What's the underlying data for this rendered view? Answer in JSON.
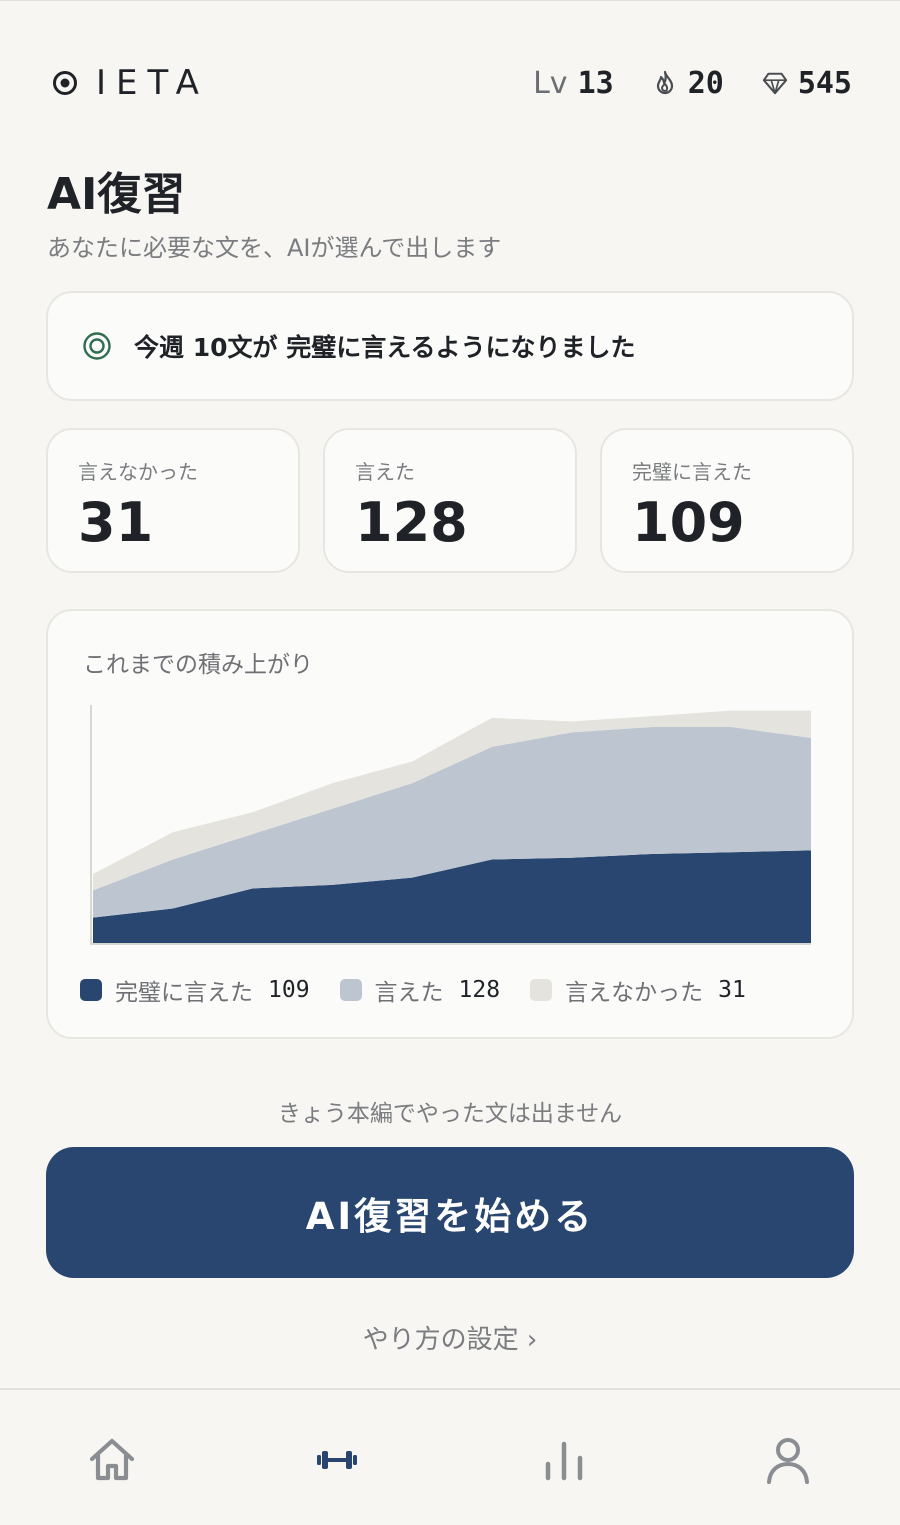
{
  "header": {
    "brand": "IETA",
    "level_prefix": "Lv",
    "level": "13",
    "streak": "20",
    "gems": "545"
  },
  "page": {
    "title": "AI復習",
    "subtitle": "あなたに必要な文を、AIが選んで出します"
  },
  "banner": {
    "text": "今週 10文が 完璧に言えるようになりました"
  },
  "counts": [
    {
      "label": "言えなかった",
      "value": "31"
    },
    {
      "label": "言えた",
      "value": "128"
    },
    {
      "label": "完璧に言えた",
      "value": "109"
    }
  ],
  "chart_data": {
    "type": "area",
    "title": "これまでの積み上がり",
    "stacked": true,
    "x": [
      0,
      1,
      2,
      3,
      4,
      5,
      6,
      7,
      8,
      9
    ],
    "series": [
      {
        "name": "完璧に言えた",
        "color": "#284670",
        "values": [
          14,
          19,
          30,
          32,
          36,
          46,
          47,
          49,
          50,
          51
        ],
        "legend_value": "109"
      },
      {
        "name": "言えた",
        "color": "#bcc5d0",
        "values": [
          15,
          27,
          30,
          42,
          52,
          62,
          69,
          70,
          69,
          62
        ],
        "legend_value": "128"
      },
      {
        "name": "言えなかった",
        "color": "#e5e3de",
        "values": [
          9,
          15,
          12,
          14,
          12,
          16,
          6,
          6,
          9,
          15
        ],
        "legend_value": "31"
      }
    ],
    "ylim": [
      0,
      130
    ]
  },
  "note": "きょう本編でやった文は出ません",
  "cta_label": "AI復習を始める",
  "settings_label": "やり方の設定 ›",
  "colors": {
    "accent": "#284670",
    "background": "#f7f6f2",
    "card": "#fbfbf9",
    "success": "#2f6e4e"
  },
  "nav": {
    "items": [
      {
        "icon": "home-icon",
        "active": false
      },
      {
        "icon": "dumbbell-icon",
        "active": true
      },
      {
        "icon": "bar-chart-icon",
        "active": false
      },
      {
        "icon": "user-icon",
        "active": false
      }
    ]
  }
}
